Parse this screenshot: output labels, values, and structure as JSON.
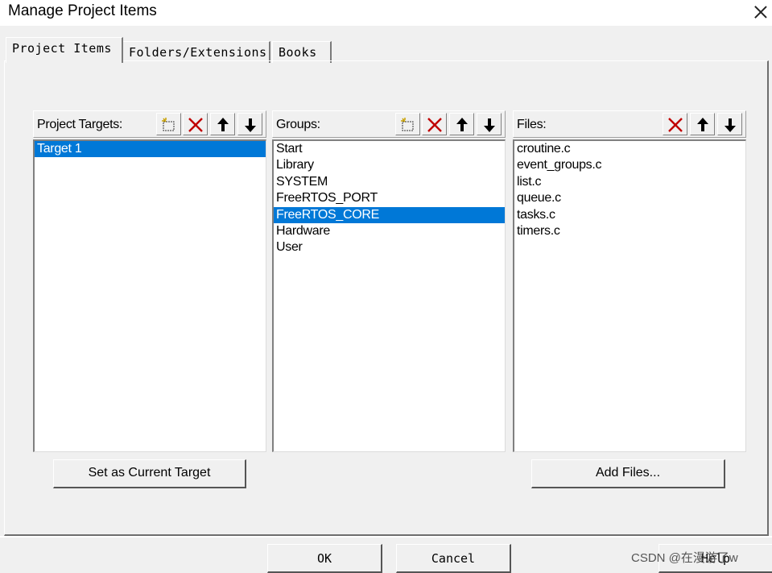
{
  "window": {
    "title": "Manage Project Items"
  },
  "tabs": [
    {
      "label": "Project Items"
    },
    {
      "label": "Folders/Extensions"
    },
    {
      "label": "Books"
    }
  ],
  "targets": {
    "label": "Project Targets:",
    "items": [
      "Target 1"
    ],
    "selected": "Target 1",
    "button": "Set as Current Target"
  },
  "groups": {
    "label": "Groups:",
    "items": [
      "Start",
      "Library",
      "SYSTEM",
      "FreeRTOS_PORT",
      "FreeRTOS_CORE",
      "Hardware",
      "User"
    ],
    "selected": "FreeRTOS_CORE"
  },
  "files": {
    "label": "Files:",
    "items": [
      "croutine.c",
      "event_groups.c",
      "list.c",
      "queue.c",
      "tasks.c",
      "timers.c"
    ],
    "button": "Add Files..."
  },
  "footer": {
    "ok": "OK",
    "cancel": "Cancel",
    "help": "Help"
  },
  "watermark": "CSDN @在漫游了w",
  "colors": {
    "selection": "#0078d7",
    "delete_icon": "#c00000"
  }
}
